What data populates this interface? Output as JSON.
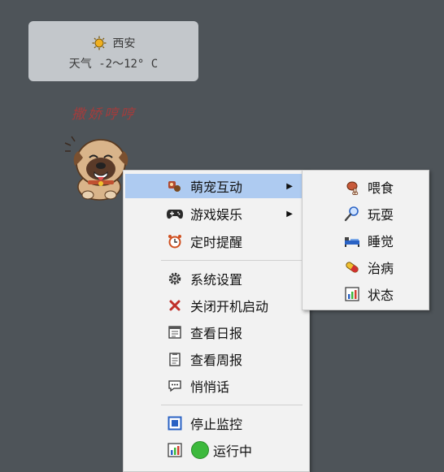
{
  "weather": {
    "city": "西安",
    "line": "天气 -2～12° C"
  },
  "pet": {
    "caption": "撒娇哼哼"
  },
  "menu": {
    "items": [
      {
        "label": "萌宠互动",
        "icon": "pet-paw-icon"
      },
      {
        "label": "游戏娱乐",
        "icon": "gamepad-icon"
      },
      {
        "label": "定时提醒",
        "icon": "alarm-clock-icon"
      },
      {
        "label": "系统设置",
        "icon": "gear-icon"
      },
      {
        "label": "关闭开机启动",
        "icon": "close-x-icon"
      },
      {
        "label": "查看日报",
        "icon": "daily-report-icon"
      },
      {
        "label": "查看周报",
        "icon": "weekly-report-icon"
      },
      {
        "label": "悄悄话",
        "icon": "chat-bubble-icon"
      },
      {
        "label": "停止监控",
        "icon": "stop-icon"
      },
      {
        "label": "运行中",
        "icon": "running-status-icon"
      }
    ],
    "arrow": "▶"
  },
  "submenu": {
    "items": [
      {
        "label": "喂食",
        "icon": "meat-icon"
      },
      {
        "label": "玩耍",
        "icon": "toy-icon"
      },
      {
        "label": "睡觉",
        "icon": "sleep-icon"
      },
      {
        "label": "治病",
        "icon": "pill-icon"
      },
      {
        "label": "状态",
        "icon": "chart-icon"
      }
    ]
  },
  "colors": {
    "desktop": "#4e5459",
    "menu_bg": "#f2f2f2",
    "highlight": "#aecbf1",
    "running": "#3cb93c"
  }
}
